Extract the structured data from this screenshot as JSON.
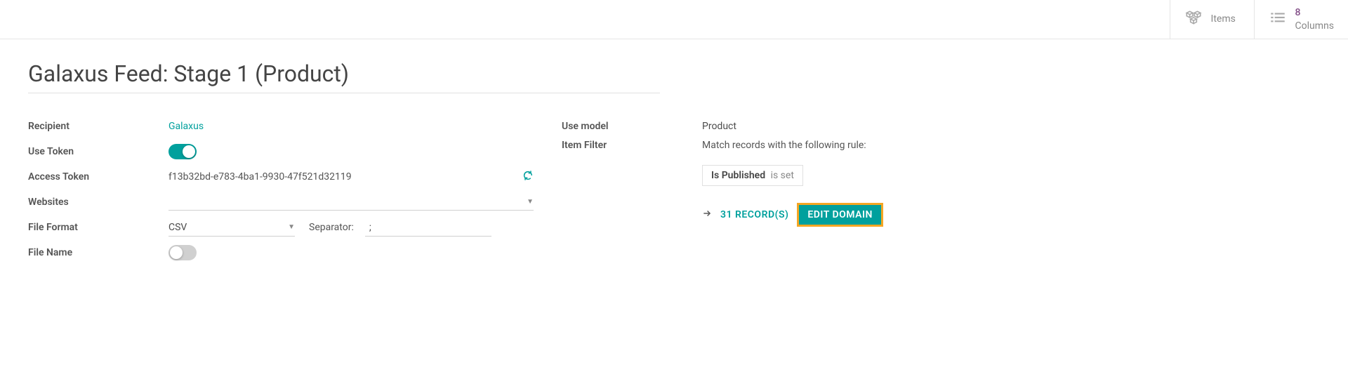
{
  "topTabs": {
    "items": {
      "label": "Items",
      "count": ""
    },
    "columns": {
      "label": "Columns",
      "count": "8"
    }
  },
  "title": "Galaxus Feed: Stage 1 (Product)",
  "leftForm": {
    "recipient": {
      "label": "Recipient",
      "value": "Galaxus"
    },
    "useToken": {
      "label": "Use Token",
      "on": true
    },
    "accessToken": {
      "label": "Access Token",
      "value": "f13b32bd-e783-4ba1-9930-47f521d32119"
    },
    "websites": {
      "label": "Websites",
      "value": ""
    },
    "fileFormat": {
      "label": "File Format",
      "value": "CSV",
      "separatorLabel": "Separator:",
      "separatorValue": ";"
    },
    "fileName": {
      "label": "File Name",
      "on": false
    }
  },
  "rightForm": {
    "useModel": {
      "label": "Use model",
      "value": "Product"
    },
    "itemFilter": {
      "label": "Item Filter",
      "description": "Match records with the following rule:",
      "ruleField": "Is Published",
      "ruleOp": "is set",
      "recordsLink": "31 RECORD(S)",
      "editDomain": "EDIT DOMAIN"
    }
  }
}
